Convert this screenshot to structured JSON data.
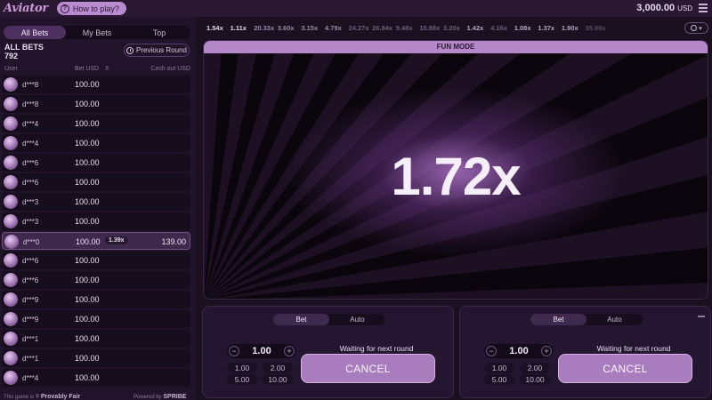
{
  "header": {
    "logo": "Aviator",
    "how_to_play": "How to play?",
    "balance": "3,000.00",
    "currency": "USD"
  },
  "bets_panel": {
    "tabs": [
      "All Bets",
      "My Bets",
      "Top"
    ],
    "all_bets_label": "ALL BETS",
    "all_bets_count": "792",
    "previous_round": "Previous Round",
    "columns": {
      "user": "User",
      "bet": "Bet USD",
      "x": "X",
      "cashout": "Cash out USD"
    },
    "rows": [
      {
        "user": "d***8",
        "bet": "100.00",
        "mult": "",
        "cashout": ""
      },
      {
        "user": "d***8",
        "bet": "100.00",
        "mult": "",
        "cashout": ""
      },
      {
        "user": "d***4",
        "bet": "100.00",
        "mult": "",
        "cashout": ""
      },
      {
        "user": "d***4",
        "bet": "100.00",
        "mult": "",
        "cashout": ""
      },
      {
        "user": "d***6",
        "bet": "100.00",
        "mult": "",
        "cashout": ""
      },
      {
        "user": "d***6",
        "bet": "100.00",
        "mult": "",
        "cashout": ""
      },
      {
        "user": "d***3",
        "bet": "100.00",
        "mult": "",
        "cashout": ""
      },
      {
        "user": "d***3",
        "bet": "100.00",
        "mult": "",
        "cashout": ""
      },
      {
        "user": "d***0",
        "bet": "100.00",
        "mult": "1.39x",
        "cashout": "139.00",
        "win": true
      },
      {
        "user": "d***6",
        "bet": "100.00",
        "mult": "",
        "cashout": ""
      },
      {
        "user": "d***6",
        "bet": "100.00",
        "mult": "",
        "cashout": ""
      },
      {
        "user": "d***9",
        "bet": "100.00",
        "mult": "",
        "cashout": ""
      },
      {
        "user": "d***9",
        "bet": "100.00",
        "mult": "",
        "cashout": ""
      },
      {
        "user": "d***1",
        "bet": "100.00",
        "mult": "",
        "cashout": ""
      },
      {
        "user": "d***1",
        "bet": "100.00",
        "mult": "",
        "cashout": ""
      },
      {
        "user": "d***4",
        "bet": "100.00",
        "mult": "",
        "cashout": ""
      }
    ],
    "footer_left_prefix": "This game is",
    "footer_left_brand": "Provably Fair",
    "footer_right_prefix": "Powered by",
    "footer_right_brand": "SPRIBE"
  },
  "history": [
    {
      "value": "1.54x",
      "color": "#e6d4ee"
    },
    {
      "value": "1.11x",
      "color": "#e6d4ee"
    },
    {
      "value": "20.33x",
      "color": "#9b86a7"
    },
    {
      "value": "3.60x",
      "color": "#9b86a7"
    },
    {
      "value": "3.15x",
      "color": "#9b86a7"
    },
    {
      "value": "4.79x",
      "color": "#9b86a7"
    },
    {
      "value": "24.27x",
      "color": "#6f5b7b"
    },
    {
      "value": "26.84x",
      "color": "#6f5b7b"
    },
    {
      "value": "5.48x",
      "color": "#6f5b7b"
    },
    {
      "value": "15.88x",
      "color": "#6f5b7b"
    },
    {
      "value": "3.20x",
      "color": "#6f5b7b"
    },
    {
      "value": "1.42x",
      "color": "#b8a4c3"
    },
    {
      "value": "4.16x",
      "color": "#6f5b7b"
    },
    {
      "value": "1.08x",
      "color": "#b8a4c3"
    },
    {
      "value": "1.37x",
      "color": "#b8a4c3"
    },
    {
      "value": "1.90x",
      "color": "#b8a4c3"
    },
    {
      "value": "35.89x",
      "color": "#5a4866"
    }
  ],
  "game": {
    "mode_label": "FUN MODE",
    "multiplier": "1.72x"
  },
  "bet_panels": [
    {
      "tabs": [
        "Bet",
        "Auto"
      ],
      "amount": "1.00",
      "minus": "−",
      "plus": "+",
      "quick": [
        "1.00",
        "2.00",
        "5.00",
        "10.00"
      ],
      "waiting": "Waiting for next round",
      "cancel": "CANCEL"
    },
    {
      "tabs": [
        "Bet",
        "Auto"
      ],
      "amount": "1.00",
      "minus": "−",
      "plus": "+",
      "quick": [
        "1.00",
        "2.00",
        "5.00",
        "10.00"
      ],
      "waiting": "Waiting for next round",
      "cancel": "CANCEL"
    }
  ]
}
